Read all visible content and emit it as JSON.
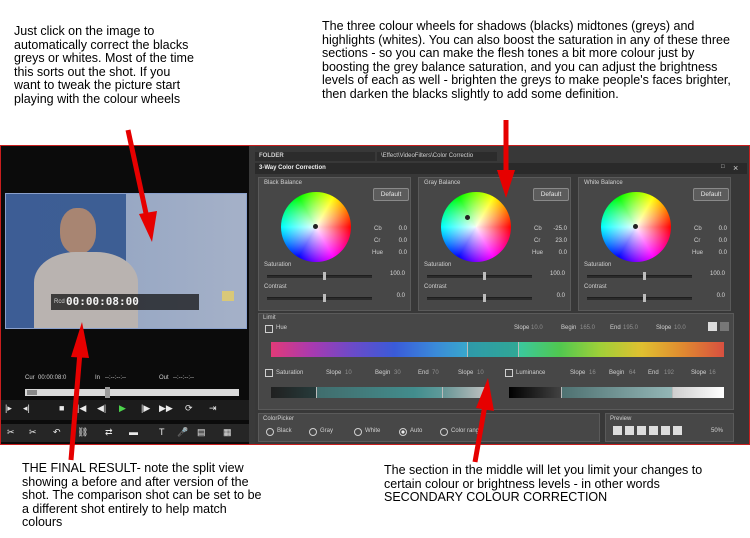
{
  "annotations": {
    "left_top": "Just click on the image to automatically correct the blacks greys or whites.  Most of the time this sorts out the shot.  If you want to tweak the picture start playing with the colour wheels",
    "right_top": "The three colour wheels for shadows (blacks) midtones (greys) and highlights (whites).  You can also boost the saturation in any of these three sections - so you can make the flesh tones a bit more colour just by boosting the grey balance saturation, and you can adjust the brightness levels of each as well - brighten the greys to make people's faces brighter, then darken the blacks slightly to add some definition.",
    "left_bottom": "THE FINAL RESULT- note the split view showing a before and after version of the shot.  The comparison shot can be set to be a different shot entirely to help match colours",
    "right_bottom": "The section in the middle will let you limit your changes to certain colour or brightness levels - in other words SECONDARY COLOUR CORRECTION"
  },
  "player": {
    "timecode_label": "Rcd",
    "timecode": "00:00:08:00",
    "cur_label": "Cur",
    "cur_value": "00:00:08:0",
    "in_label": "In",
    "in_value": "--:--:--:--",
    "out_label": "Out",
    "out_value": "--:--:--:--"
  },
  "header": {
    "folder_tab": "FOLDER",
    "path": "\\Effect\\VideoFilters\\Color Correctio"
  },
  "window": {
    "title": "3-Way Color Correction",
    "close_glyph": "×"
  },
  "balances": [
    {
      "title": "Black Balance",
      "default_label": "Default",
      "cb_label": "Cb",
      "cb": "0.0",
      "cr_label": "Cr",
      "cr": "0.0",
      "hue_label": "Hue",
      "hue": "0.0",
      "saturation_label": "Saturation",
      "saturation": "100.0",
      "contrast_label": "Contrast",
      "contrast": "0.0"
    },
    {
      "title": "Gray Balance",
      "default_label": "Default",
      "cb_label": "Cb",
      "cb": "-25.0",
      "cr_label": "Cr",
      "cr": "23.0",
      "hue_label": "Hue",
      "hue": "0.0",
      "saturation_label": "Saturation",
      "saturation": "100.0",
      "contrast_label": "Contrast",
      "contrast": "0.0"
    },
    {
      "title": "White Balance",
      "default_label": "Default",
      "cb_label": "Cb",
      "cb": "0.0",
      "cr_label": "Cr",
      "cr": "0.0",
      "hue_label": "Hue",
      "hue": "0.0",
      "saturation_label": "Saturation",
      "saturation": "100.0",
      "contrast_label": "Contrast",
      "contrast": "0.0"
    }
  ],
  "limit": {
    "title": "Limit",
    "hue_label": "Hue",
    "hue_slope1_label": "Slope",
    "hue_slope1": "10.0",
    "hue_begin_label": "Begin",
    "hue_begin": "165.0",
    "hue_end_label": "End",
    "hue_end": "195.0",
    "hue_slope2_label": "Slope",
    "hue_slope2": "10.0",
    "sat_label": "Saturation",
    "sat_slope1_label": "Slope",
    "sat_slope1": "10",
    "sat_begin_label": "Begin",
    "sat_begin": "30",
    "sat_end_label": "End",
    "sat_end": "70",
    "sat_slope2_label": "Slope",
    "sat_slope2": "10",
    "lum_label": "Luminance",
    "lum_slope1_label": "Slope",
    "lum_slope1": "16",
    "lum_begin_label": "Begin",
    "lum_begin": "64",
    "lum_end_label": "End",
    "lum_end": "192",
    "lum_slope2_label": "Slope",
    "lum_slope2": "16"
  },
  "colorpicker": {
    "title": "ColorPicker",
    "options": [
      "Black",
      "Gray",
      "White",
      "Auto",
      "Color range"
    ]
  },
  "preview": {
    "title": "Preview",
    "zoom": "50%"
  }
}
